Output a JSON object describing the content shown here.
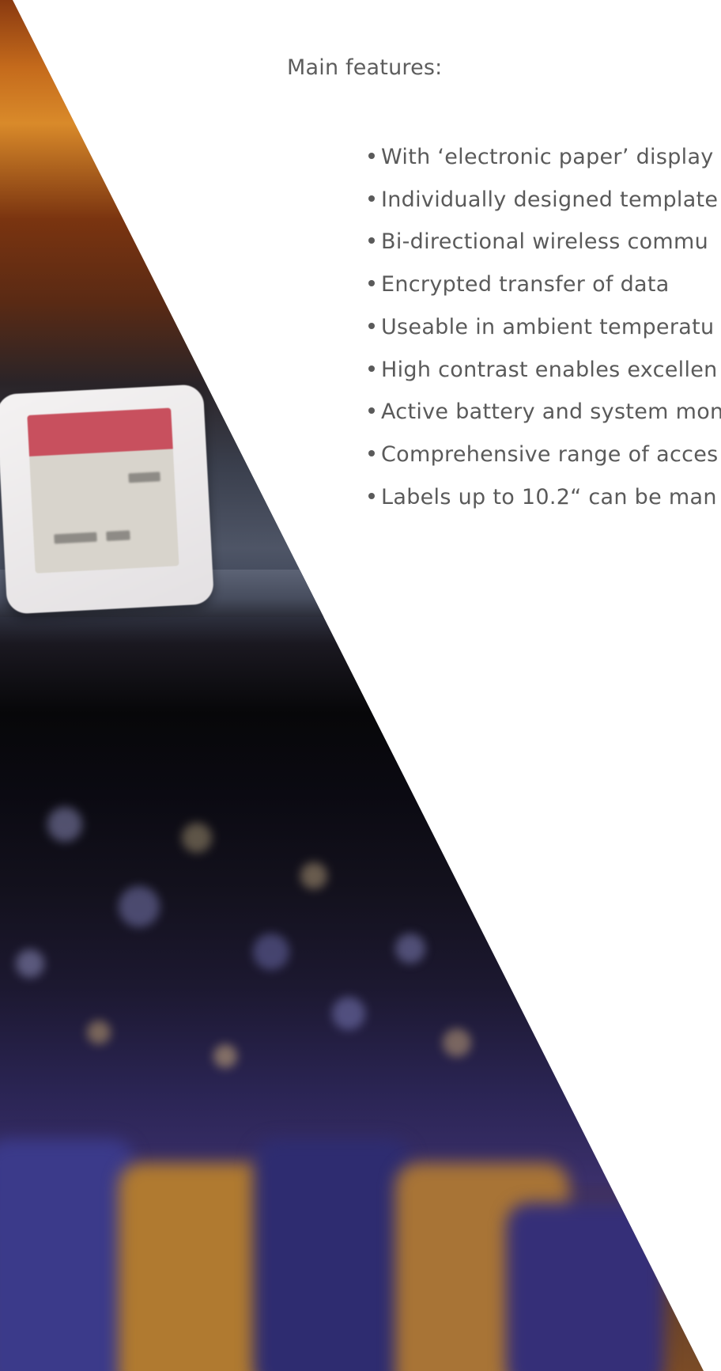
{
  "heading": "Main features:",
  "features": [
    "With ‘electronic paper’ display",
    "Individually designed template",
    "Bi-directional wireless commu",
    "Encrypted transfer of data",
    "Useable in ambient temperatu",
    "High contrast enables excellen",
    "Active battery and system mon",
    "Comprehensive range of acces",
    "Labels up to 10.2“ can be man"
  ],
  "colors": {
    "text": "#5a5a5a",
    "background": "#ffffff",
    "label_red": "#c8505e"
  }
}
